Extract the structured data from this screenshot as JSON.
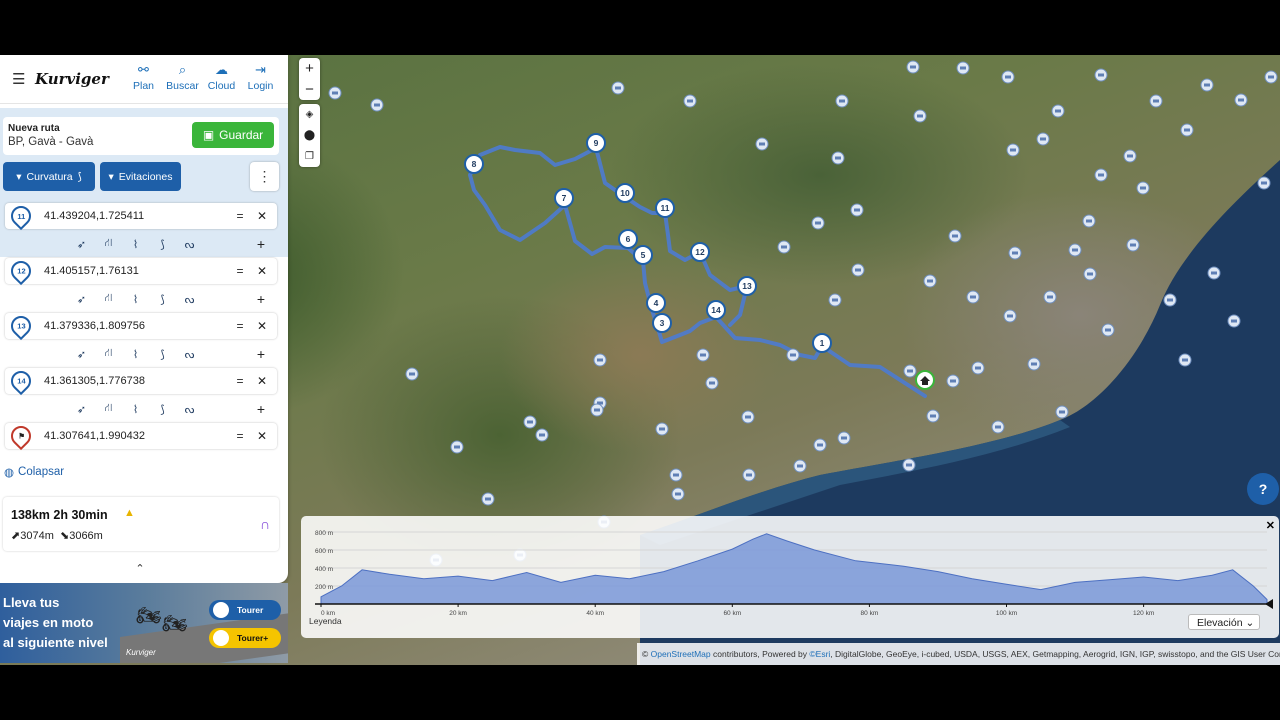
{
  "app": {
    "logo": "Kurviger",
    "nav": [
      {
        "label": "Plan",
        "icon": "plan-icon"
      },
      {
        "label": "Buscar",
        "icon": "search-icon"
      },
      {
        "label": "Cloud",
        "icon": "cloud-icon"
      },
      {
        "label": "Login",
        "icon": "login-icon"
      }
    ]
  },
  "route": {
    "name_label": "Nueva ruta",
    "name_value": "BP, Gavà - Gavà",
    "save_label": "Guardar",
    "curvature_label": "Curvatura",
    "avoid_label": "Evitaciones"
  },
  "waypoints": [
    {
      "num": "11",
      "coord": "41.439204,1.725411"
    },
    {
      "num": "12",
      "coord": "41.405157,1.76131"
    },
    {
      "num": "13",
      "coord": "41.379336,1.809756"
    },
    {
      "num": "14",
      "coord": "41.361305,1.776738"
    },
    {
      "num": "",
      "coord": "41.307641,1.990432",
      "end": true
    }
  ],
  "collapse_label": "Colapsar",
  "summary": {
    "distance_time": "138km  2h 30min",
    "ascent": "3074m",
    "descent": "3066m",
    "warning_icon": "warning-icon"
  },
  "ad": {
    "line1": "Lleva tus",
    "line2": "viajes en moto",
    "line3": "al siguiente nivel",
    "brand": "Kurviger",
    "tourer": "Tourer",
    "tourer_plus": "Tourer+"
  },
  "map": {
    "markers": [
      {
        "n": "1",
        "lon": 1.95,
        "lat": 41.34
      },
      {
        "n": "3",
        "lon": 1.78,
        "lat": 41.355
      },
      {
        "n": "4",
        "lon": 1.77,
        "lat": 41.37
      },
      {
        "n": "5",
        "lon": 1.77,
        "lat": 41.4
      },
      {
        "n": "6",
        "lon": 1.76,
        "lat": 41.41
      },
      {
        "n": "7",
        "lon": 1.68,
        "lat": 41.44
      },
      {
        "n": "8",
        "lon": 1.6,
        "lat": 41.46
      },
      {
        "n": "9",
        "lon": 1.72,
        "lat": 41.48
      },
      {
        "n": "10",
        "lon": 1.745,
        "lat": 41.45
      },
      {
        "n": "11",
        "lon": 1.725,
        "lat": 41.44
      },
      {
        "n": "12",
        "lon": 1.76,
        "lat": 41.405
      },
      {
        "n": "13",
        "lon": 1.81,
        "lat": 41.38
      },
      {
        "n": "14",
        "lon": 1.775,
        "lat": 41.36
      }
    ],
    "attribution_osm": "OpenStreetMap",
    "attribution_mid": " contributors, Powered by ",
    "attribution_esri": "©Esri",
    "attribution_rest": ", DigitalGlobe, GeoEye, i-cubed, USDA, USGS, AEX, Getmapping, Aerogrid, IGN, IGP, swisstopo, and the GIS User Community",
    "colors": {
      "route": "#4d7bd1",
      "marker_border": "#1e5fa8",
      "accent": "#1e5fa8",
      "save": "#3ab53a"
    }
  },
  "chart_data": {
    "type": "area",
    "title": "",
    "xlabel": "",
    "ylabel": "",
    "x_unit": "km",
    "y_unit": "m",
    "xlim": [
      0,
      138
    ],
    "ylim": [
      0,
      800
    ],
    "x_ticks": [
      "0 km",
      "20 km",
      "40 km",
      "60 km",
      "80 km",
      "100 km",
      "120 km"
    ],
    "y_ticks": [
      "200 m",
      "400 m",
      "600 m",
      "800 m"
    ],
    "x": [
      0,
      3,
      6,
      10,
      15,
      20,
      25,
      30,
      35,
      40,
      45,
      50,
      55,
      60,
      63,
      65,
      68,
      72,
      78,
      85,
      90,
      95,
      100,
      105,
      110,
      115,
      120,
      125,
      130,
      133,
      136,
      138
    ],
    "values": [
      80,
      200,
      380,
      330,
      280,
      310,
      260,
      350,
      240,
      320,
      280,
      360,
      480,
      610,
      720,
      780,
      700,
      600,
      480,
      420,
      360,
      280,
      220,
      160,
      240,
      270,
      300,
      260,
      320,
      380,
      200,
      50
    ],
    "legend_label": "Leyenda",
    "selector": "Elevación"
  }
}
